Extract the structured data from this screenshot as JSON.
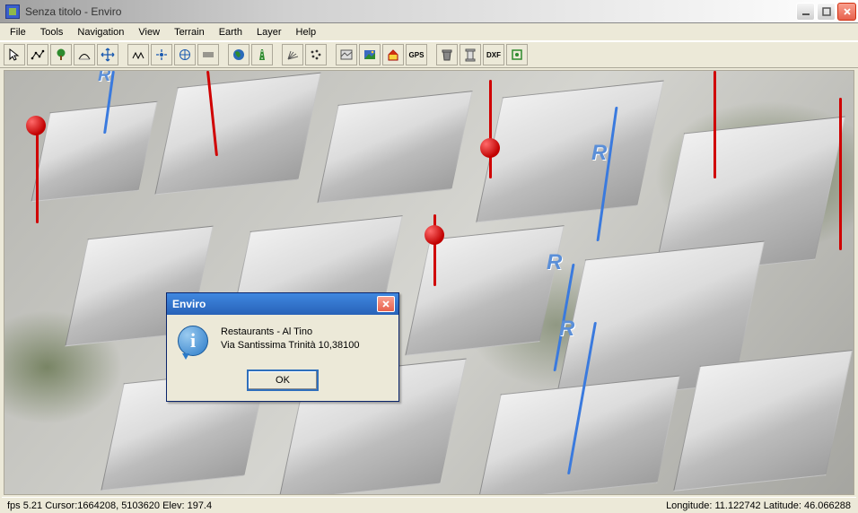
{
  "titlebar": {
    "title": "Senza titolo - Enviro"
  },
  "menubar": {
    "items": [
      "File",
      "Tools",
      "Navigation",
      "View",
      "Terrain",
      "Earth",
      "Layer",
      "Help"
    ]
  },
  "toolbar": {
    "icons": [
      "pointer",
      "fence-poly",
      "tree",
      "path",
      "move",
      "|",
      "repeat",
      "four-arrows",
      "compass",
      "layers-line",
      "|",
      "globe",
      "road",
      "|",
      "fan-rays",
      "dots-grid",
      "|",
      "picture-flat",
      "picture-color",
      "house",
      "gps-text",
      "|",
      "trash",
      "column",
      "dxf-text",
      "target-box"
    ],
    "dxf_label": "DXF",
    "gps_label": "GPS"
  },
  "dialog": {
    "title": "Enviro",
    "line1": "Restaurants - Al Tino",
    "line2": "Via Santissima Trinità 10,38100",
    "ok_label": "OK"
  },
  "statusbar": {
    "left": "fps 5.21  Cursor:1664208, 5103620  Elev: 197.4",
    "right": "Longitude: 11.122742   Latitude: 46.066288"
  }
}
